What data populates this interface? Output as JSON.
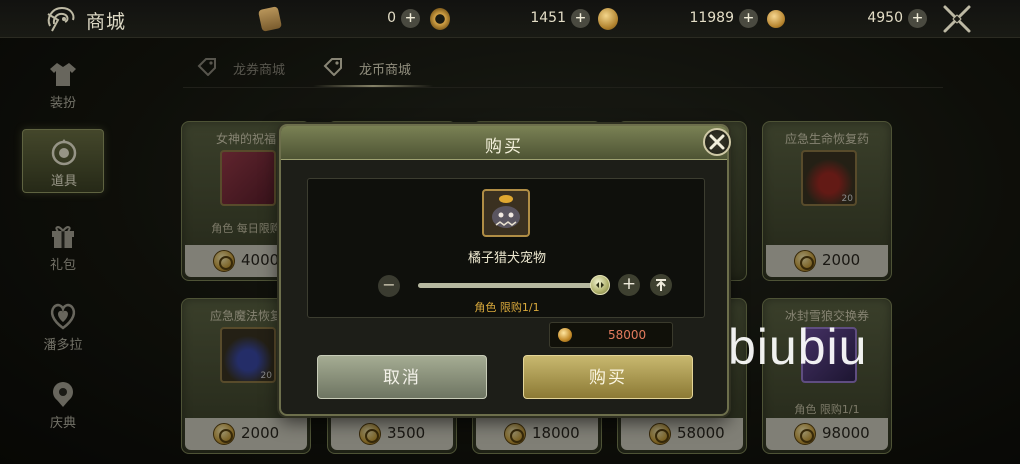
{
  "topbar": {
    "title": "商城",
    "currencies": [
      {
        "icon": "ticket-icon",
        "value": "0"
      },
      {
        "icon": "dragon-coin-icon",
        "value": "1451"
      },
      {
        "icon": "bag-coin-icon",
        "value": "11989"
      },
      {
        "icon": "gold-coin-icon",
        "value": "4950"
      }
    ]
  },
  "sidebar": {
    "items": [
      {
        "label": "装扮",
        "icon": "outfit-icon"
      },
      {
        "label": "道具",
        "icon": "item-icon",
        "active": true
      },
      {
        "label": "礼包",
        "icon": "gift-icon"
      },
      {
        "label": "潘多拉",
        "icon": "pandora-icon"
      },
      {
        "label": "庆典",
        "icon": "celebration-icon"
      }
    ]
  },
  "tabs": [
    {
      "label": "龙券商城",
      "icon": "tag-icon"
    },
    {
      "label": "龙币商城",
      "icon": "tag-icon",
      "active": true
    }
  ],
  "cards": [
    {
      "name": "女神的祝福",
      "limit": "角色 每日限购",
      "price": "4000"
    },
    {
      "name": "应急生命恢复药",
      "qty": "20",
      "price": "2000"
    },
    {
      "name": "应急魔法恢复",
      "qty": "20",
      "price": "2000"
    },
    {
      "price": "3500"
    },
    {
      "price": "18000"
    },
    {
      "price": "58000"
    },
    {
      "name": "冰封雪狼交换券",
      "limit": "角色 限购1/1",
      "price": "98000"
    }
  ],
  "dialog": {
    "title": "购买",
    "item_name": "橘子猎犬宠物",
    "limit": "角色 限购1/1",
    "slider_fraction": 1.0,
    "cost": "58000",
    "cancel_label": "取消",
    "buy_label": "购买"
  },
  "watermark": "biubiu"
}
